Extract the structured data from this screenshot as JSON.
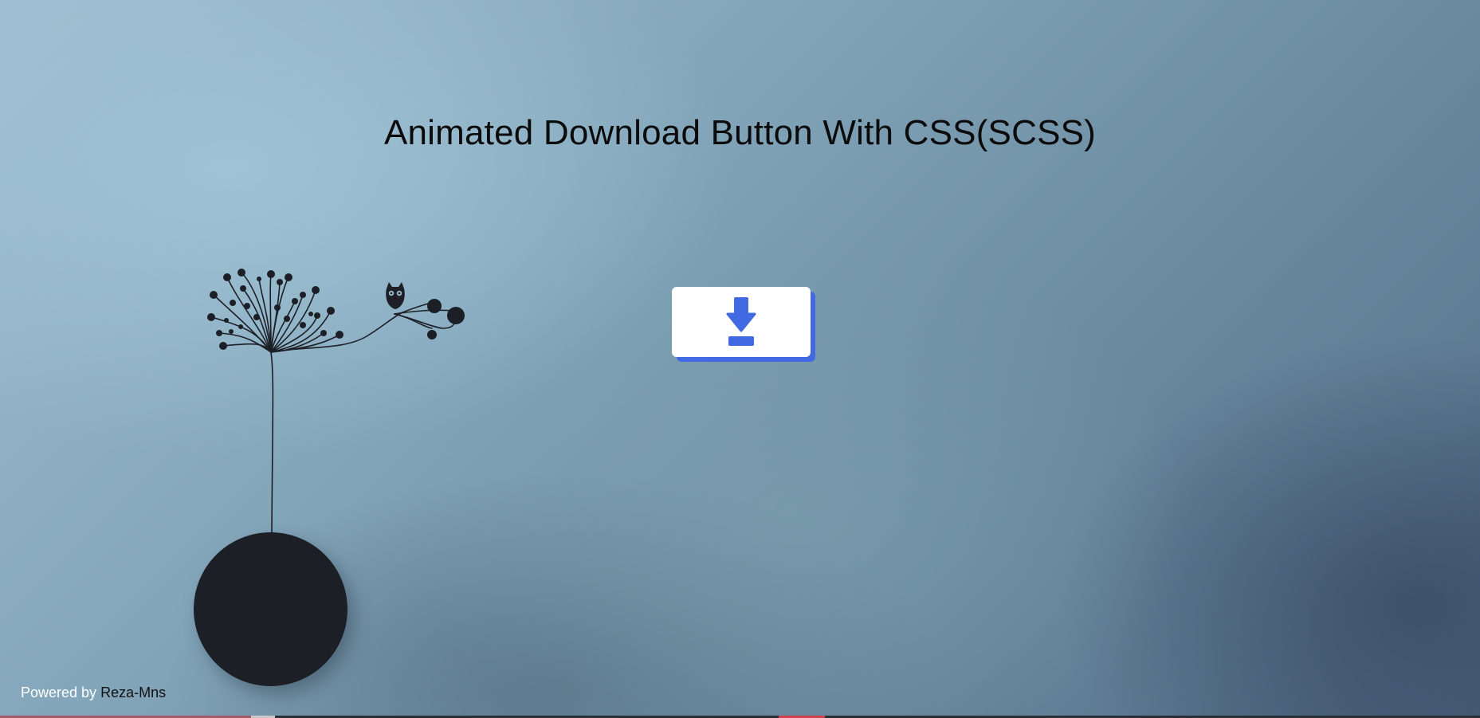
{
  "page": {
    "title": "Animated Download Button With CSS(SCSS)"
  },
  "download": {
    "icon": "download-arrow-icon",
    "accent_color": "#4169e1",
    "background_color": "#ffffff"
  },
  "illustration": {
    "tree_icon": "tree-with-owl-icon",
    "planet_color": "#1d1f26"
  },
  "footer": {
    "prefix": "Powered by",
    "author": "Reza-Mns"
  }
}
